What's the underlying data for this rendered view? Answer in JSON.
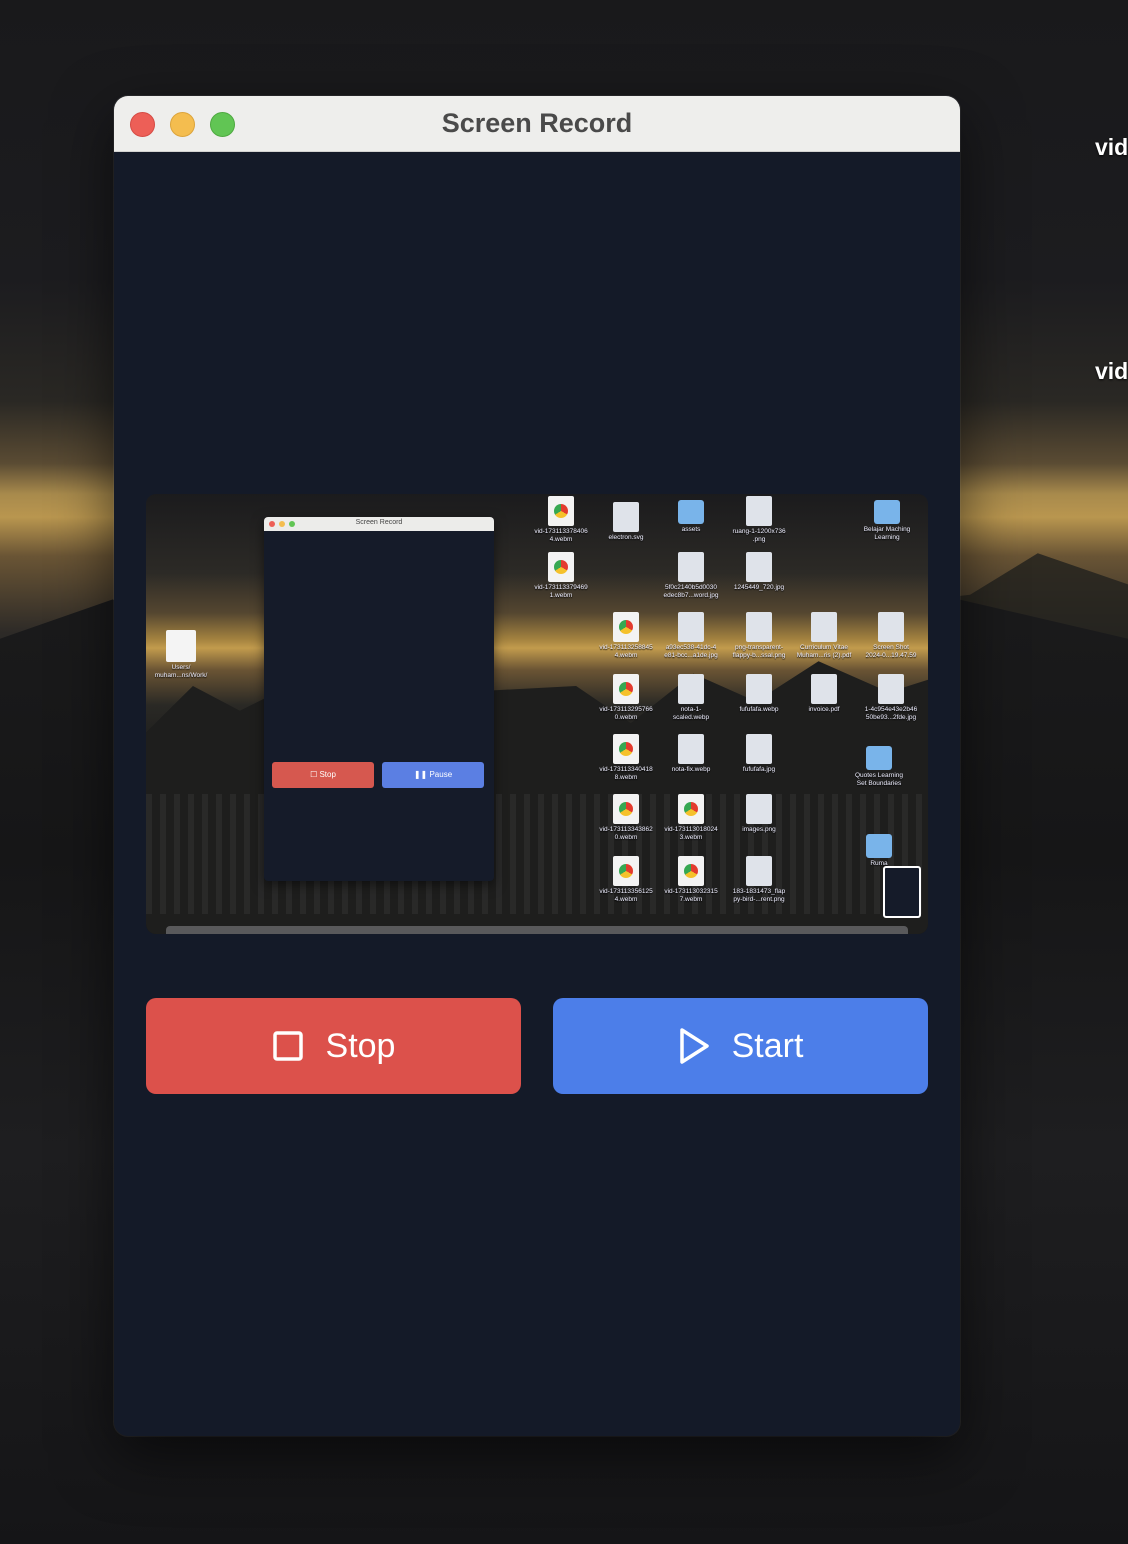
{
  "desktop": {
    "side_labels": [
      "vid",
      "vid"
    ]
  },
  "window": {
    "title": "Screen Record",
    "traffic_lights": [
      "close",
      "minimize",
      "zoom"
    ],
    "colors": {
      "background": "#141a28",
      "stop": "#dc514b",
      "start": "#4c7ee9"
    }
  },
  "preview": {
    "mini_window": {
      "title": "Screen Record",
      "stop_label": "Stop",
      "pause_label": "Pause"
    },
    "left_file_label": "Users/\nmuham...ns/Work/",
    "desktop_icons": [
      {
        "label": "vid-173113378406\n4.webm",
        "kind": "file"
      },
      {
        "label": "electron.svg",
        "kind": "image"
      },
      {
        "label": "assets",
        "kind": "folder"
      },
      {
        "label": "ruang-1-1200x736\n.png",
        "kind": "image"
      },
      {
        "label": "Belajar Maching\nLearning",
        "kind": "folder"
      },
      {
        "label": "vid-173113379469\n1.webm",
        "kind": "file"
      },
      {
        "label": "5f0c2140b5d0030\nedec8b7...word.jpg",
        "kind": "image"
      },
      {
        "label": "1245449_720.jpg",
        "kind": "image"
      },
      {
        "label": "vid-173113258845\n4.webm",
        "kind": "file"
      },
      {
        "label": "a93ec538-41dc-4\ne81-bcc...a1de.jpg",
        "kind": "image"
      },
      {
        "label": "png-transparent-\nflappy-b...ssal.png",
        "kind": "image"
      },
      {
        "label": "Curriculum Vitae\nMuham...ris (2).pdf",
        "kind": "image"
      },
      {
        "label": "Screen Shot\n2024-0...19.47.59",
        "kind": "image"
      },
      {
        "label": "vid-173113295766\n0.webm",
        "kind": "file"
      },
      {
        "label": "nota-1-\nscaled.webp",
        "kind": "image"
      },
      {
        "label": "fufufafa.webp",
        "kind": "image"
      },
      {
        "label": "invoice.pdf",
        "kind": "image"
      },
      {
        "label": "1-4c954e43e2b46\n50be93...2fde.jpg",
        "kind": "image"
      },
      {
        "label": "vid-173113340418\n8.webm",
        "kind": "file"
      },
      {
        "label": "nota-fix.webp",
        "kind": "image"
      },
      {
        "label": "fufufafa.jpg",
        "kind": "image"
      },
      {
        "label": "Quotes Learning\nSet Boundaries",
        "kind": "folder"
      },
      {
        "label": "vid-173113343862\n0.webm",
        "kind": "file"
      },
      {
        "label": "vid-173113018024\n3.webm",
        "kind": "file"
      },
      {
        "label": "images.png",
        "kind": "image"
      },
      {
        "label": "Ruma",
        "kind": "folder"
      },
      {
        "label": "vid-173113356125\n4.webm",
        "kind": "file"
      },
      {
        "label": "vid-173113032315\n7.webm",
        "kind": "file"
      },
      {
        "label": "183-1831473_flap\npy-bird-...rent.png",
        "kind": "image"
      }
    ]
  },
  "controls": {
    "stop": {
      "label": "Stop",
      "icon": "square-stop-icon"
    },
    "start": {
      "label": "Start",
      "icon": "play-icon"
    }
  }
}
